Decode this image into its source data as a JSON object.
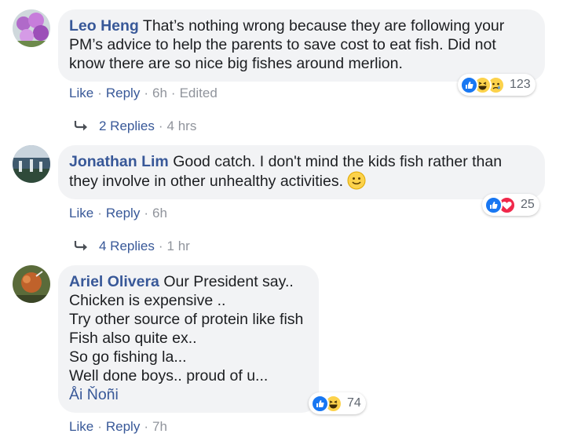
{
  "comments": [
    {
      "author": "Leo Heng",
      "text_lines": [
        "That’s nothing wrong because they are following your",
        "PM’s advice to help the parents to save cost to eat fish. Did not",
        "know there are so nice big fishes around merlion."
      ],
      "actions": {
        "like": "Like",
        "reply": "Reply",
        "time": "6h",
        "edited": "Edited"
      },
      "reaction_count": "123",
      "reaction_icons": [
        "like-icon",
        "haha-icon",
        "sad-icon"
      ],
      "replies": {
        "label": "2 Replies",
        "time": "4 hrs"
      }
    },
    {
      "author": "Jonathan Lim",
      "text_lines": [
        "Good catch. I don't mind the kids fish rather than",
        "they involve in other unhealthy activities."
      ],
      "actions": {
        "like": "Like",
        "reply": "Reply",
        "time": "6h"
      },
      "reaction_count": "25",
      "reaction_icons": [
        "like-icon",
        "love-icon"
      ],
      "replies": {
        "label": "4 Replies",
        "time": "1 hr"
      }
    },
    {
      "author": "Ariel Olivera",
      "text_lines": [
        "Our President say..",
        "Chicken is expensive ..",
        "Try other source of protein like fish",
        "Fish also quite ex..",
        "So go fishing la...",
        "Well done boys.. proud of u..."
      ],
      "tag": "Åi Ňoñi",
      "actions": {
        "like": "Like",
        "reply": "Reply",
        "time": "7h"
      },
      "reaction_count": "74",
      "reaction_icons": [
        "like-icon",
        "haha-icon"
      ]
    }
  ],
  "colors": {
    "link": "#385898",
    "meta": "#90949c",
    "bubble": "#f2f3f5",
    "like": "#1877f2",
    "love": "#f0284a",
    "haha": "#fcd24b"
  }
}
